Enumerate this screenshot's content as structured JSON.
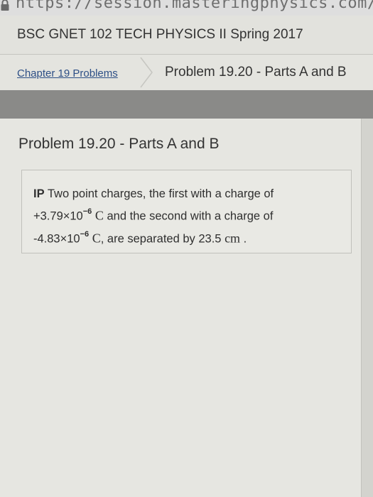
{
  "browser": {
    "url": "https://session.masteringphysics.com/myct/ite"
  },
  "course": {
    "title": "BSC GNET 102 TECH PHYSICS II Spring 2017"
  },
  "breadcrumb": {
    "link": "Chapter 19 Problems",
    "current": "Problem 19.20 - Parts A and B"
  },
  "problem": {
    "title": "Problem 19.20 - Parts A and B",
    "tag": "IP",
    "text_1": "Two point charges, the first with a charge of",
    "charge1_mantissa": "+3.79×10",
    "charge1_exp": "−6",
    "unit_C": "C",
    "text_2": "and the second with a charge of",
    "charge2_mantissa": "-4.83×10",
    "charge2_exp": "−6",
    "text_3": ", are separated by 23.5",
    "unit_cm": "cm",
    "text_end": "."
  }
}
